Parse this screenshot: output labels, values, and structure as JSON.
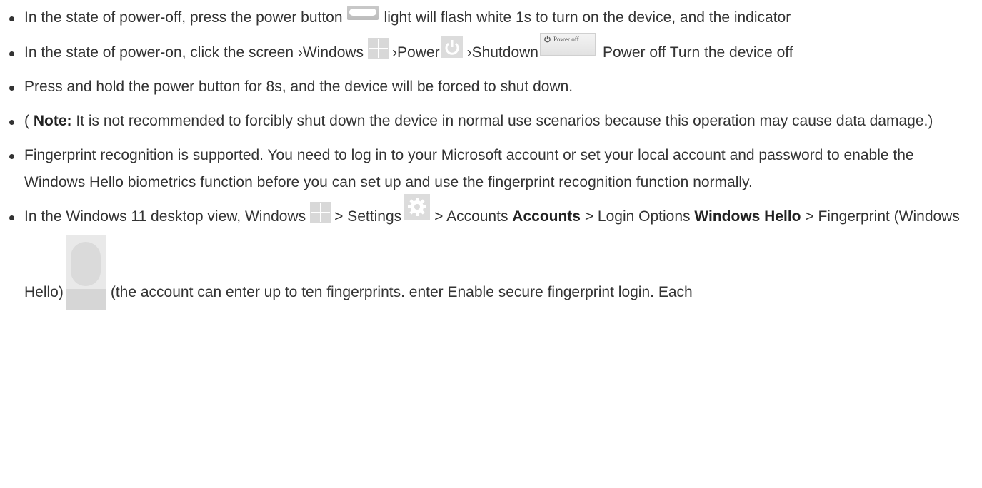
{
  "items": [
    {
      "part1": "In the state of power-off, press the power button",
      "part2": "light will flash white 1s to turn on the device, and the indicator"
    },
    {
      "part1": "In the state of power-on, click the screen ›Windows",
      "part2": "›Power",
      "part3": "›Shutdown",
      "part4": "Power off Turn the device off",
      "poweroff_icon_text": "Power off"
    },
    {
      "text": "Press and hold the power button for 8s, and the device will be forced to shut down."
    },
    {
      "prefix": "(",
      "bold": "Note:",
      "text": "It is not recommended to forcibly shut down the device in normal use scenarios because this operation may cause data damage.)"
    },
    {
      "text": "Fingerprint recognition is supported. You need to log in to your Microsoft account or set your local account and password to enable the Windows Hello biometrics function before you can set up and use the fingerprint recognition function normally."
    },
    {
      "part1": "In the Windows 11 desktop view, Windows",
      "part2": "> Settings",
      "part3": "> Accounts",
      "bold1": "Accounts",
      "part4": "> Login Options",
      "bold2": "Windows Hello",
      "part5": "> Fingerprint (Windows Hello)",
      "part6": "(the account can enter up to ten fingerprints. enter Enable secure fingerprint login. Each"
    }
  ],
  "icons": {
    "power_button": "power-button-icon",
    "windows": "windows-icon",
    "power": "power-icon",
    "shutdown": "power-off-button-icon",
    "settings": "settings-gear-icon",
    "fingerprint": "fingerprint-icon"
  }
}
